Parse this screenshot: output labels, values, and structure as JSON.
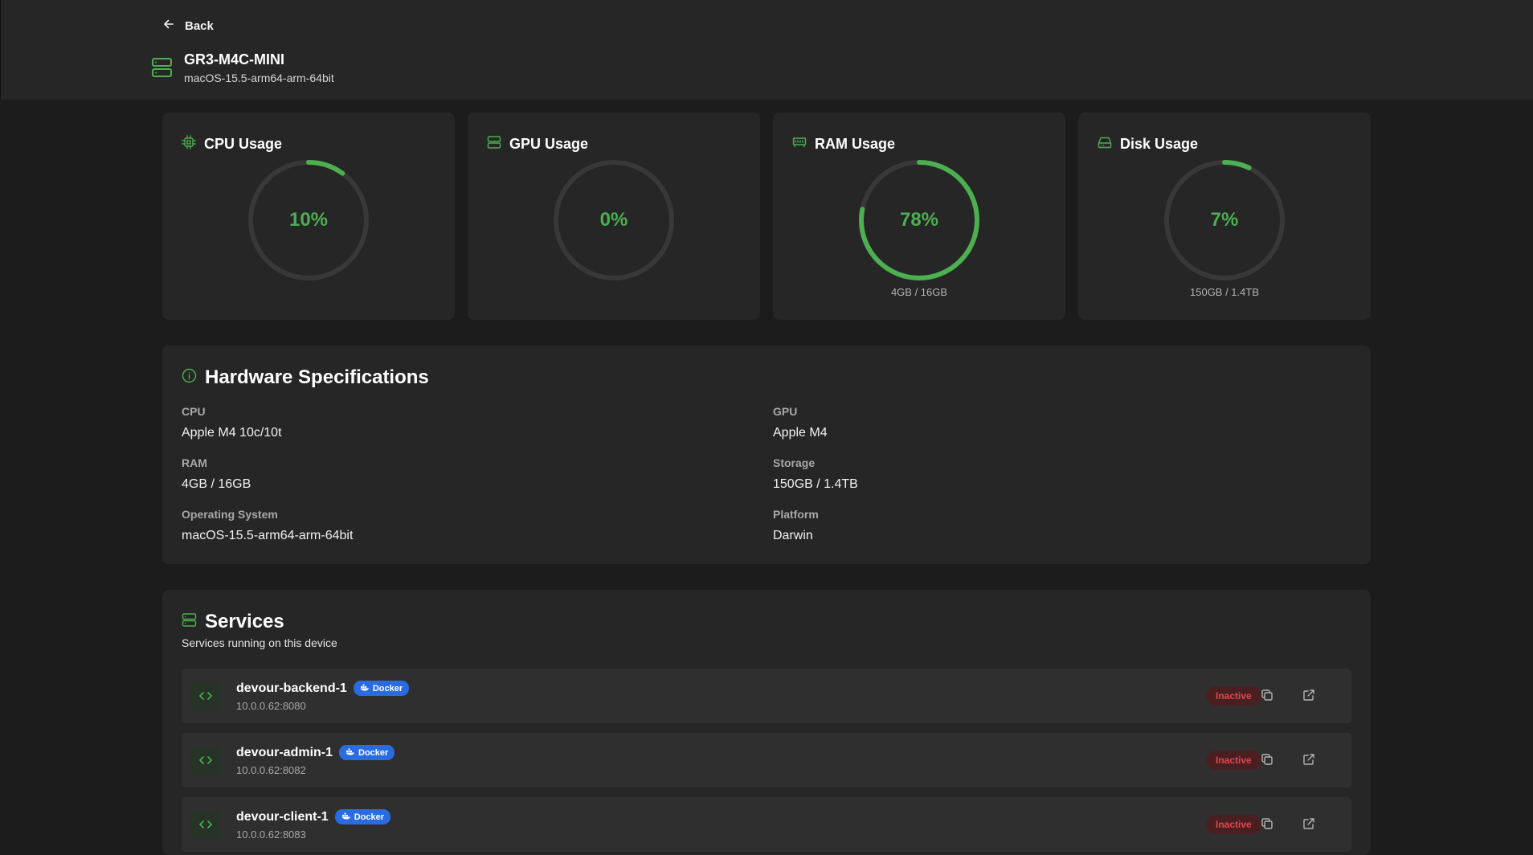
{
  "header": {
    "back_label": "Back",
    "device_name": "GR3-M4C-MINI",
    "device_os": "macOS-15.5-arm64-arm-64bit"
  },
  "usage": [
    {
      "title": "CPU Usage",
      "icon": "cpu-icon",
      "percent": 10,
      "value_label": "10%",
      "sub": ""
    },
    {
      "title": "GPU Usage",
      "icon": "gpu-icon",
      "percent": 0,
      "value_label": "0%",
      "sub": ""
    },
    {
      "title": "RAM Usage",
      "icon": "ram-icon",
      "percent": 78,
      "value_label": "78%",
      "sub": "4GB / 16GB"
    },
    {
      "title": "Disk Usage",
      "icon": "disk-icon",
      "percent": 7,
      "value_label": "7%",
      "sub": "150GB / 1.4TB"
    }
  ],
  "hardware": {
    "title": "Hardware Specifications",
    "specs": [
      {
        "label": "CPU",
        "value": "Apple M4 10c/10t"
      },
      {
        "label": "GPU",
        "value": "Apple M4"
      },
      {
        "label": "RAM",
        "value": "4GB / 16GB"
      },
      {
        "label": "Storage",
        "value": "150GB / 1.4TB"
      },
      {
        "label": "Operating System",
        "value": "macOS-15.5-arm64-arm-64bit"
      },
      {
        "label": "Platform",
        "value": "Darwin"
      }
    ]
  },
  "services": {
    "title": "Services",
    "subtitle": "Services running on this device",
    "items": [
      {
        "name": "devour-backend-1",
        "badge": "Docker",
        "address": "10.0.0.62:8080",
        "status": "Inactive"
      },
      {
        "name": "devour-admin-1",
        "badge": "Docker",
        "address": "10.0.0.62:8082",
        "status": "Inactive"
      },
      {
        "name": "devour-client-1",
        "badge": "Docker",
        "address": "10.0.0.62:8083",
        "status": "Inactive"
      }
    ]
  },
  "colors": {
    "accent": "#4caf50",
    "track": "#383838",
    "card": "#262626",
    "background": "#1c1c1c",
    "inactive": "#e0474c",
    "docker": "#2a6bdf"
  }
}
